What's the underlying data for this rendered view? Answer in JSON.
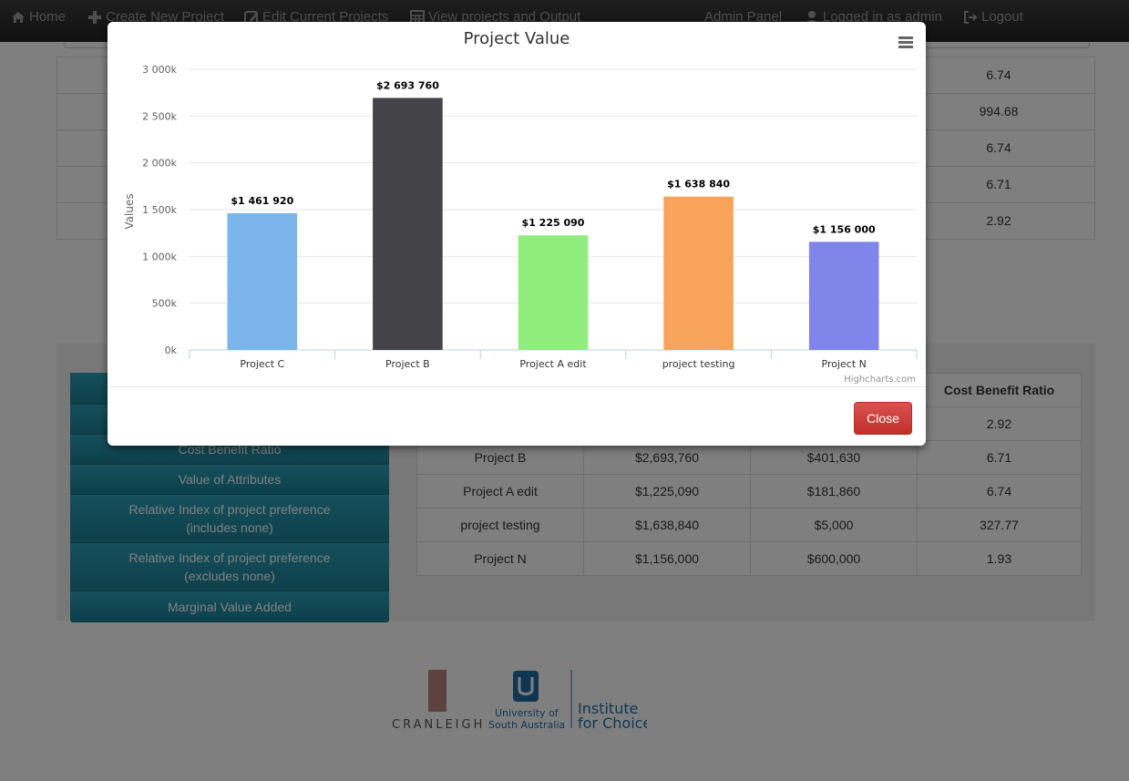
{
  "nav": {
    "home": "Home",
    "create": "Create New Project",
    "edit": "Edit Current Projects",
    "view": "View projects and Output",
    "admin": "Admin Panel",
    "logged": "Logged in as admin",
    "logout": "Logout"
  },
  "background_top_values": [
    "6.74",
    "994.68",
    "6.74",
    "6.71",
    "2.92"
  ],
  "side_menu": {
    "items": [
      {
        "label": ""
      },
      {
        "label": ""
      },
      {
        "label": "Cost Benefit Ratio"
      },
      {
        "label": "Value of Attributes"
      },
      {
        "label": "Relative Index of project preference\n(includes none)"
      },
      {
        "label": "Relative Index of project preference\n(excludes none)"
      },
      {
        "label": "Marginal Value Added"
      }
    ]
  },
  "results_table": {
    "header_last": "Cost Benefit Ratio",
    "first_row_last": "2.92",
    "rows": [
      {
        "name": "Project B",
        "value": "$2,693,760",
        "cost": "$401,630",
        "ratio": "6.71"
      },
      {
        "name": "Project A edit",
        "value": "$1,225,090",
        "cost": "$181,860",
        "ratio": "6.74"
      },
      {
        "name": "project testing",
        "value": "$1,638,840",
        "cost": "$5,000",
        "ratio": "327.77"
      },
      {
        "name": "Project N",
        "value": "$1,156,000",
        "cost": "$600,000",
        "ratio": "1.93"
      }
    ]
  },
  "logos": {
    "cranleigh": "CRANLEIGH",
    "unisa_line1": "University of",
    "unisa_line2": "South Australia",
    "ifc_line1": "Institute",
    "ifc_line2": "for Choice"
  },
  "modal": {
    "close_label": "Close",
    "credits": "Highcharts.com"
  },
  "chart_data": {
    "type": "bar",
    "title": "Project Value",
    "ylabel": "Values",
    "xlabel": "",
    "categories": [
      "Project C",
      "Project B",
      "Project A edit",
      "project testing",
      "Project N"
    ],
    "values": [
      1461920,
      2693760,
      1225090,
      1638840,
      1156000
    ],
    "data_labels": [
      "$1 461 920",
      "$2 693 760",
      "$1 225 090",
      "$1 638 840",
      "$1 156 000"
    ],
    "colors": [
      "#7cb5ec",
      "#434348",
      "#90ed7d",
      "#f7a35c",
      "#8085e9"
    ],
    "yticks": [
      "0k",
      "500k",
      "1 000k",
      "1 500k",
      "2 000k",
      "2 500k",
      "3 000k"
    ],
    "ylim": [
      0,
      3000000
    ],
    "grid": true,
    "legend": "none"
  }
}
